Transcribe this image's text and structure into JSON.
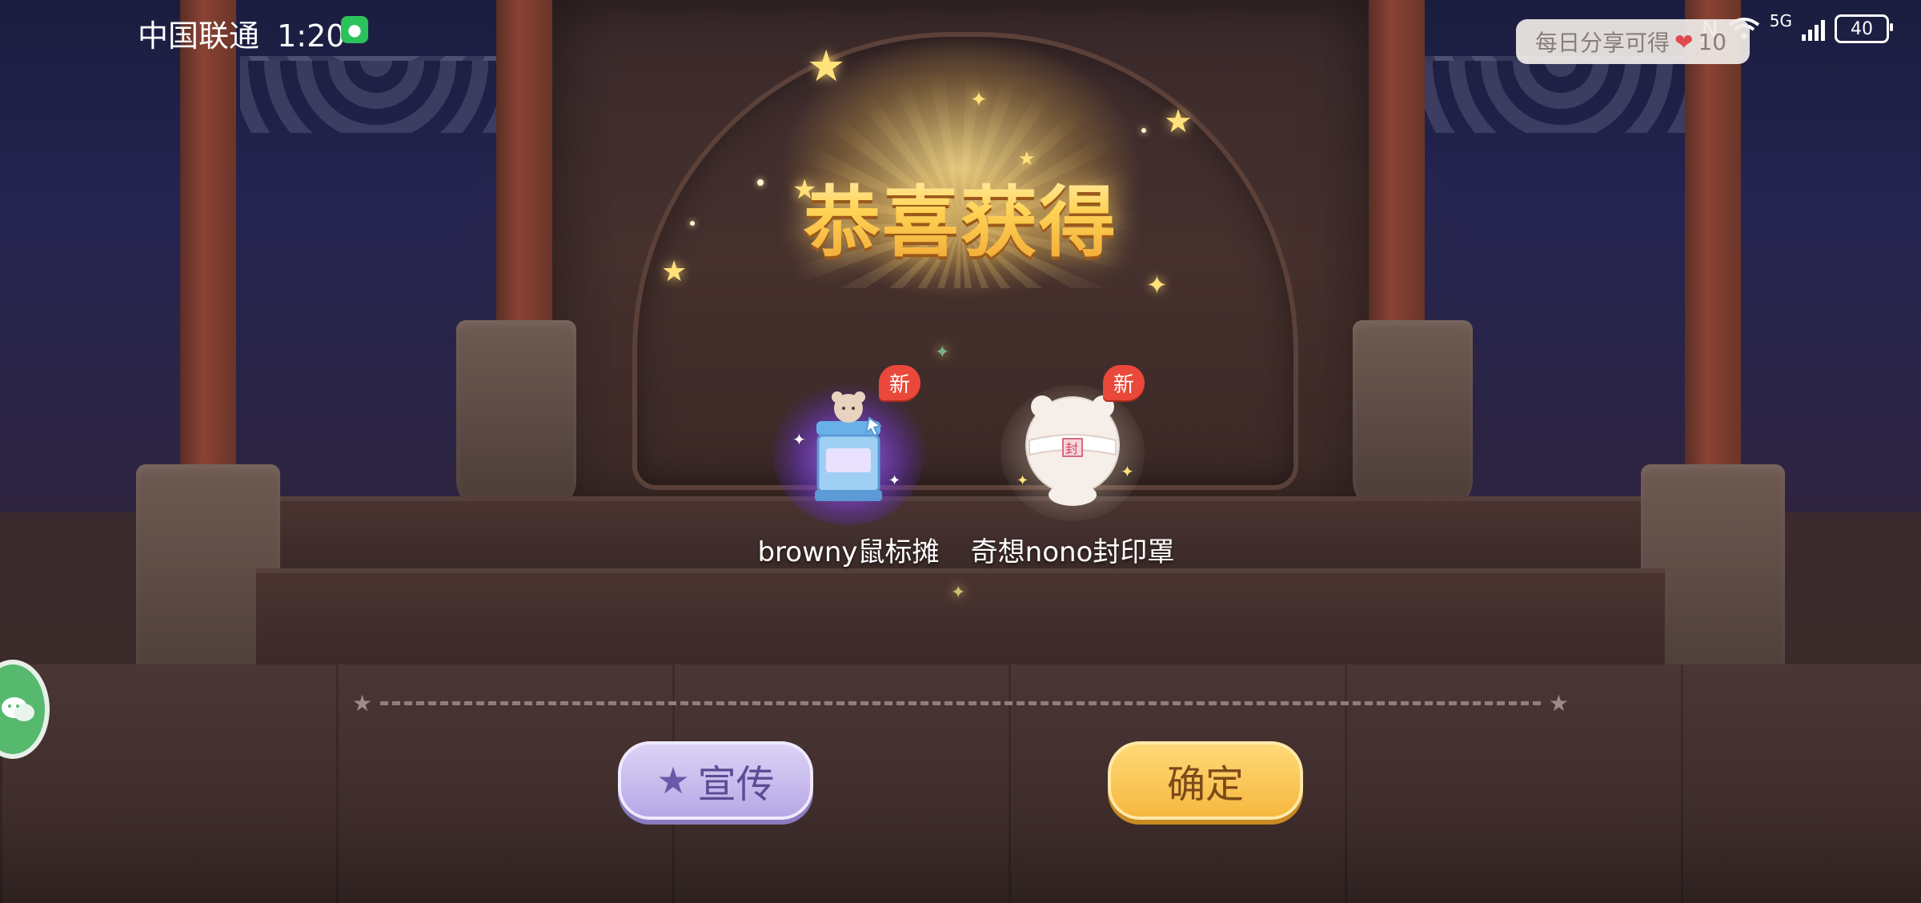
{
  "status_bar": {
    "carrier": "中国联通",
    "time": "1:20",
    "network": "5G",
    "battery": "40"
  },
  "share_tip": {
    "text": "每日分享可得",
    "amount": "10"
  },
  "reward_panel": {
    "title": "恭喜获得",
    "items": [
      {
        "label": "browny鼠标摊",
        "badge": "新"
      },
      {
        "label": "奇想nono封印罩",
        "badge": "新"
      }
    ]
  },
  "buttons": {
    "promote": "宣传",
    "confirm": "确定"
  },
  "colors": {
    "title_gold": "#ffd25a",
    "promote_bg": "#c6b8ee",
    "confirm_bg": "#f8c24e",
    "new_badge": "#e9483a"
  }
}
